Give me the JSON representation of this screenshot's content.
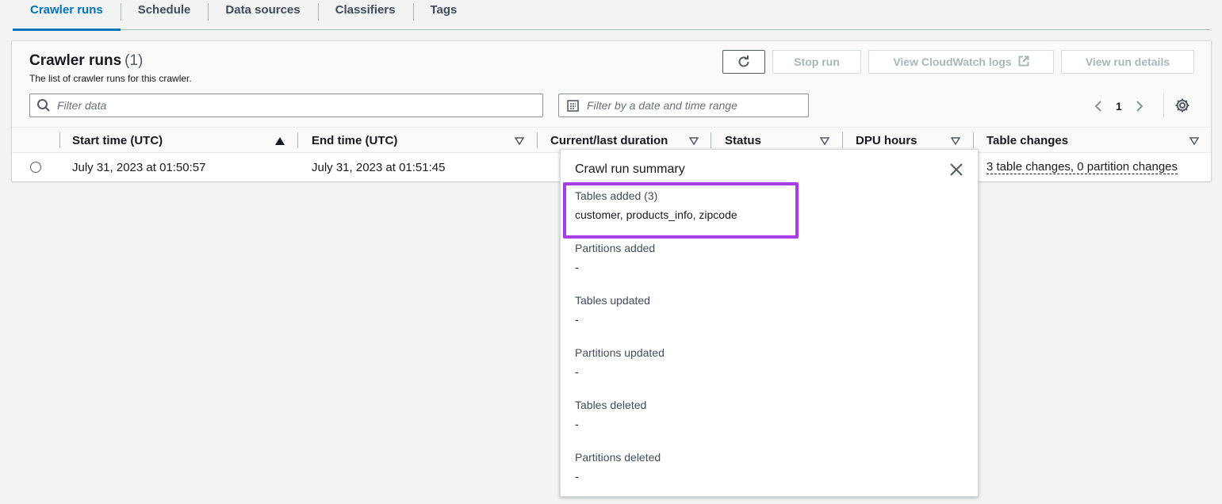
{
  "tabs": [
    {
      "label": "Crawler runs",
      "active": true
    },
    {
      "label": "Schedule",
      "active": false
    },
    {
      "label": "Data sources",
      "active": false
    },
    {
      "label": "Classifiers",
      "active": false
    },
    {
      "label": "Tags",
      "active": false
    }
  ],
  "panel": {
    "title": "Crawler runs",
    "count": "(1)",
    "subtitle": "The list of crawler runs for this crawler.",
    "buttons": {
      "refresh_icon": "refresh-icon",
      "stop": "Stop run",
      "logs": "View CloudWatch logs",
      "details": "View run details"
    },
    "search_placeholder": "Filter data",
    "date_placeholder": "Filter by a date and time range",
    "page": "1"
  },
  "table": {
    "columns": [
      "Start time (UTC)",
      "End time (UTC)",
      "Current/last duration",
      "Status",
      "DPU hours",
      "Table changes"
    ],
    "rows": [
      {
        "start": "July 31, 2023 at 01:50:57",
        "end": "July 31, 2023 at 01:51:45",
        "table_changes": "3 table changes, 0 partition changes"
      }
    ]
  },
  "popover": {
    "title": "Crawl run summary",
    "sections": [
      {
        "label": "Tables added (3)",
        "value": "customer, products_info, zipcode"
      },
      {
        "label": "Partitions added",
        "value": "-"
      },
      {
        "label": "Tables updated",
        "value": "-"
      },
      {
        "label": "Partitions updated",
        "value": "-"
      },
      {
        "label": "Tables deleted",
        "value": "-"
      },
      {
        "label": "Partitions deleted",
        "value": "-"
      }
    ]
  },
  "colors": {
    "accent": "#0073bb",
    "highlight": "#a43fe6"
  }
}
